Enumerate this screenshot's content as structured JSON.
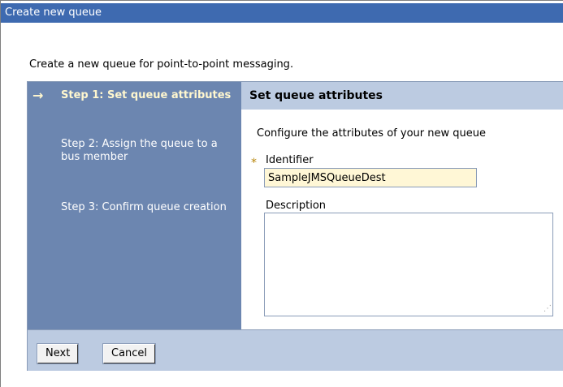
{
  "window": {
    "title": "Create new queue"
  },
  "intro": "Create a new queue for point-to-point messaging.",
  "steps": [
    {
      "label": "Step 1: Set queue attributes",
      "current": true
    },
    {
      "label": "Step 2: Assign the queue to a bus member",
      "current": false
    },
    {
      "label": "Step 3: Confirm queue creation",
      "current": false
    }
  ],
  "current_step_indicator": "→",
  "panel": {
    "title": "Set queue attributes",
    "instructions": "Configure the attributes of your new queue",
    "required_marker": "*",
    "identifier": {
      "label": "Identifier",
      "value": "SampleJMSQueueDest"
    },
    "description": {
      "label": "Description",
      "value": ""
    },
    "resize_grip": "⋰"
  },
  "buttons": {
    "next": "Next",
    "cancel": "Cancel"
  },
  "colors": {
    "titlebar": "#3e6ab0",
    "steps_panel": "#6c86b0",
    "current_step_text": "#fff7cf",
    "header_band": "#bccbe1",
    "input_highlight": "#fff7d6"
  }
}
